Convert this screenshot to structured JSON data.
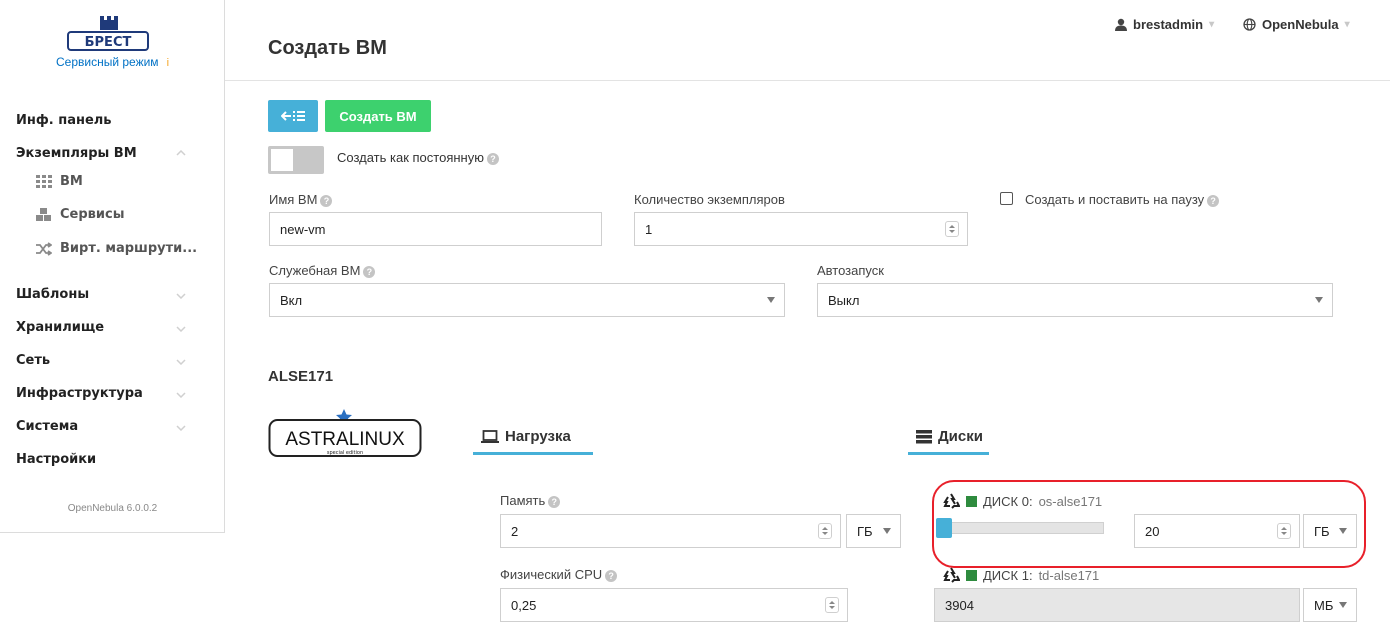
{
  "sidebar": {
    "logo_text": "БРЕСТ",
    "service_mode": "Сервисный режим",
    "service_info": "i",
    "items": [
      {
        "label": "Инф. панель"
      },
      {
        "label": "Экземпляры ВМ"
      },
      {
        "label": "ВМ"
      },
      {
        "label": "Сервисы"
      },
      {
        "label": "Вирт. маршрути..."
      },
      {
        "label": "Шаблоны"
      },
      {
        "label": "Хранилище"
      },
      {
        "label": "Сеть"
      },
      {
        "label": "Инфраструктура"
      },
      {
        "label": "Система"
      },
      {
        "label": "Настройки"
      }
    ],
    "version": "OpenNebula 6.0.0.2"
  },
  "topbar": {
    "user": "brestadmin",
    "zone": "OpenNebula"
  },
  "page": {
    "title": "Создать ВМ"
  },
  "toolbar": {
    "create_label": "Создать ВМ"
  },
  "form": {
    "persistent_label": "Создать как постоянную",
    "vm_name_label": "Имя ВМ",
    "vm_name_value": "new-vm",
    "instances_label": "Количество экземпляров",
    "instances_value": "1",
    "hold_label": "Создать и поставить на паузу",
    "service_vm_label": "Служебная ВМ",
    "service_vm_value": "Вкл",
    "autostart_label": "Автозапуск",
    "autostart_value": "Выкл"
  },
  "template": {
    "name": "ALSE171",
    "logo_text": "ASTRALINUX",
    "logo_sub": "special edition",
    "tabs": {
      "load": "Нагрузка",
      "disks": "Диски"
    },
    "memory_label": "Память",
    "memory_value": "2",
    "memory_unit": "ГБ",
    "cpu_label": "Физический CPU",
    "cpu_value": "0,25",
    "disk0": {
      "prefix": "ДИСК 0:",
      "name": "os-alse171",
      "size": "20",
      "unit": "ГБ",
      "slider_fraction": 0.0
    },
    "disk1": {
      "prefix": "ДИСК 1:",
      "name": "td-alse171",
      "size": "3904",
      "unit": "МБ"
    }
  },
  "colors": {
    "accent": "#46b0d8",
    "create": "#3dd16e",
    "disk_square": "#2e8b3e",
    "highlight": "#e8202a"
  }
}
